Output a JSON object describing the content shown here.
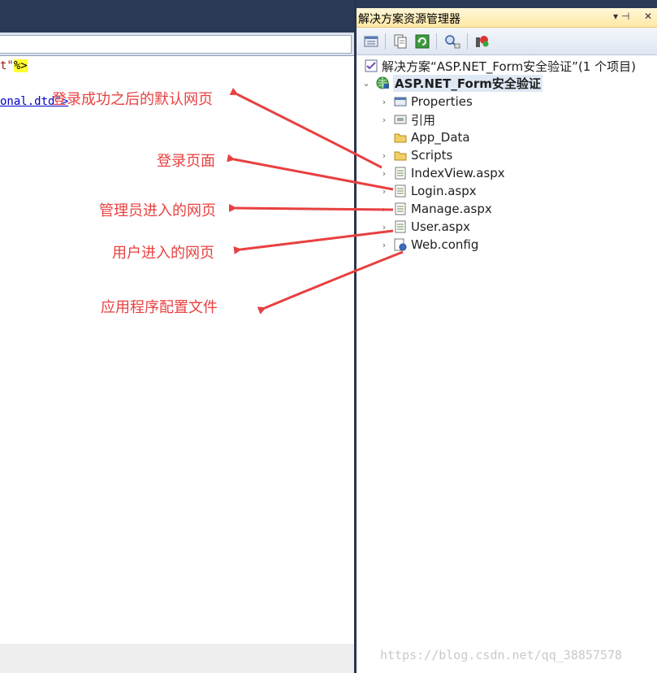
{
  "editor": {
    "code_lines": [
      {
        "text": "t\"",
        "highlight": "%>"
      },
      {
        "text": "onal.dtd\">"
      }
    ]
  },
  "solution_explorer": {
    "title": "解决方案资源管理器",
    "controls": {
      "pin": "▾ ⊣",
      "close": "✕"
    },
    "toolbar": [
      "properties-icon",
      "show-all-files-icon",
      "refresh-icon",
      "view-code-icon",
      "view-designer-icon"
    ],
    "tree": {
      "solution": "解决方案“ASP.NET_Form安全验证”(1 个项目)",
      "project": "ASP.NET_Form安全验证",
      "items": [
        {
          "label": "Properties",
          "icon": "properties-icon",
          "expandable": true
        },
        {
          "label": "引用",
          "icon": "references-icon",
          "expandable": true
        },
        {
          "label": "App_Data",
          "icon": "folder-icon",
          "expandable": false
        },
        {
          "label": "Scripts",
          "icon": "folder-icon",
          "expandable": true
        },
        {
          "label": "IndexView.aspx",
          "icon": "aspx-file-icon",
          "expandable": true
        },
        {
          "label": "Login.aspx",
          "icon": "aspx-file-icon",
          "expandable": true
        },
        {
          "label": "Manage.aspx",
          "icon": "aspx-file-icon",
          "expandable": true
        },
        {
          "label": "User.aspx",
          "icon": "aspx-file-icon",
          "expandable": true
        },
        {
          "label": "Web.config",
          "icon": "config-file-icon",
          "expandable": true
        }
      ]
    }
  },
  "annotations": [
    "登录成功之后的默认网页",
    "登录页面",
    "管理员进入的网页",
    "用户进入的网页",
    "应用程序配置文件"
  ],
  "watermark": "https://blog.csdn.net/qq_38857578",
  "colors": {
    "annotation": "#e84040",
    "title_bar": "#ffe8a6",
    "ide_frame": "#2b3a55"
  }
}
